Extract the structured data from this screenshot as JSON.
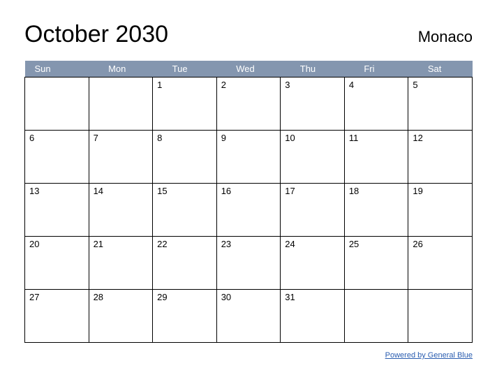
{
  "header": {
    "title": "October 2030",
    "region": "Monaco"
  },
  "calendar": {
    "day_headers": [
      "Sun",
      "Mon",
      "Tue",
      "Wed",
      "Thu",
      "Fri",
      "Sat"
    ],
    "weeks": [
      [
        "",
        "",
        "1",
        "2",
        "3",
        "4",
        "5"
      ],
      [
        "6",
        "7",
        "8",
        "9",
        "10",
        "11",
        "12"
      ],
      [
        "13",
        "14",
        "15",
        "16",
        "17",
        "18",
        "19"
      ],
      [
        "20",
        "21",
        "22",
        "23",
        "24",
        "25",
        "26"
      ],
      [
        "27",
        "28",
        "29",
        "30",
        "31",
        "",
        ""
      ]
    ]
  },
  "footer": {
    "link_text": "Powered by General Blue"
  }
}
